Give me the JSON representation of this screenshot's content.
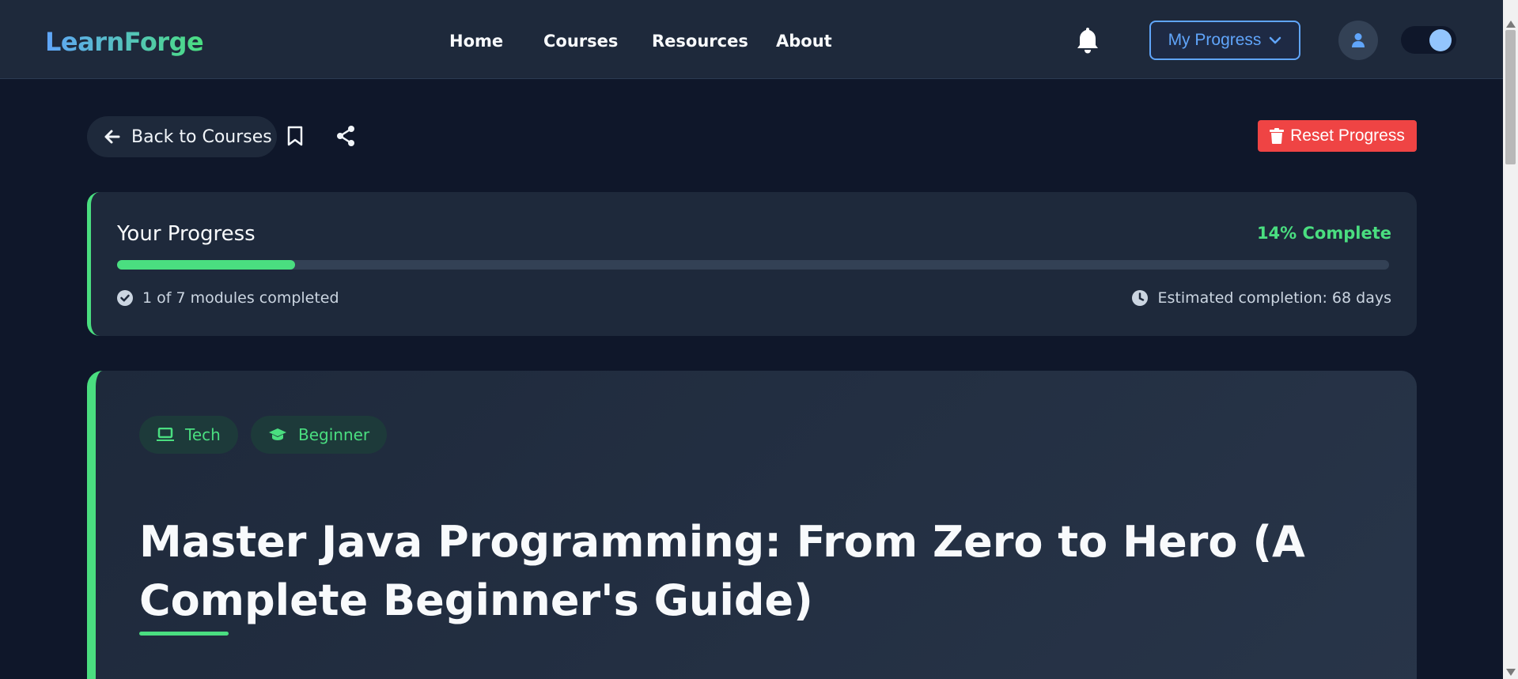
{
  "nav": {
    "brand": "LearnForge",
    "links": [
      "Home",
      "Courses",
      "Resources",
      "About"
    ],
    "progress_button": "My Progress"
  },
  "actions": {
    "back_label": "Back to Courses",
    "reset_label": "Reset Progress"
  },
  "progress": {
    "title": "Your Progress",
    "percent_label": "14% Complete",
    "percent_value": 14,
    "modules_label": "1 of 7 modules completed",
    "eta_label": "Estimated completion: 68 days"
  },
  "course": {
    "tags": [
      "Tech",
      "Beginner"
    ],
    "title": "Master Java Programming: From Zero to Hero (A Complete Beginner's Guide)"
  },
  "colors": {
    "accent": "#4ade80",
    "primary": "#60a5fa",
    "danger": "#ef4444",
    "background": "#0f172a",
    "surface": "#1e293b"
  },
  "icons": {
    "bell": "bell-icon",
    "chevron": "chevron-down-icon",
    "user": "user-icon",
    "back": "arrow-left-icon",
    "bookmark": "bookmark-icon",
    "share": "share-icon",
    "trash": "trash-icon",
    "check": "check-circle-icon",
    "clock": "clock-icon",
    "laptop": "laptop-icon",
    "cap": "graduation-cap-icon"
  }
}
